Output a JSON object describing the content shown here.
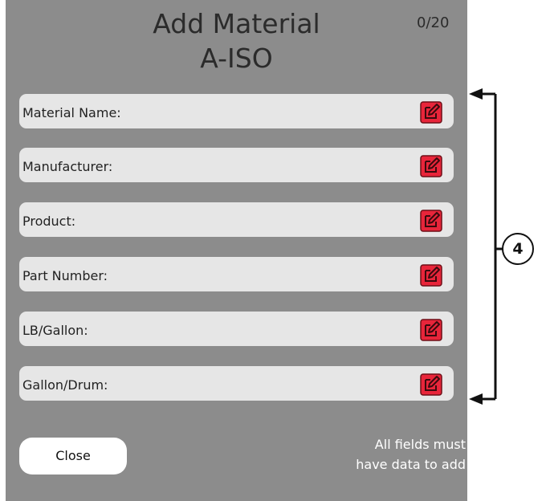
{
  "header": {
    "title_line1": "Add Material",
    "title_line2": "A-ISO",
    "counter": "0/20"
  },
  "fields": [
    {
      "label": "Material Name:"
    },
    {
      "label": "Manufacturer:"
    },
    {
      "label": "Product:"
    },
    {
      "label": "Part Number:"
    },
    {
      "label": "LB/Gallon:"
    },
    {
      "label": "Gallon/Drum:"
    }
  ],
  "footer": {
    "close_label": "Close",
    "notice_line1": "All fields must",
    "notice_line2": "have data to add"
  },
  "callout": {
    "number": "4"
  },
  "icons": {
    "edit": "edit-pencil-icon"
  },
  "colors": {
    "panel": "#8c8c8c",
    "field": "#e6e6e6",
    "edit_icon": "#e8253a"
  }
}
